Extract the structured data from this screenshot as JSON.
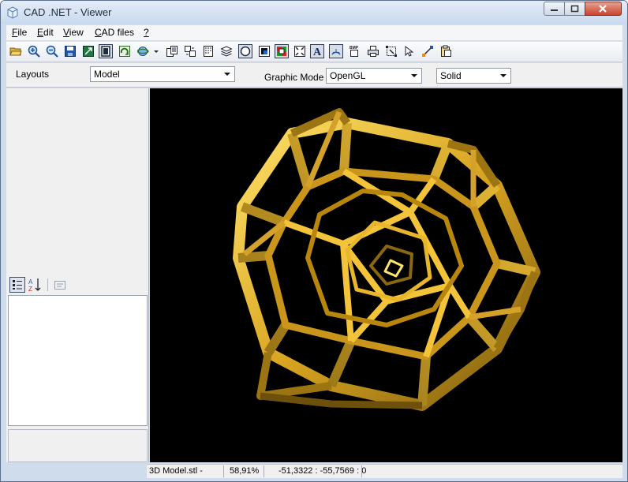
{
  "window": {
    "title": "CAD .NET - Viewer",
    "app_icon": "cube-icon"
  },
  "menu": [
    {
      "label": "File",
      "hotkey_char": "F"
    },
    {
      "label": "Edit",
      "hotkey_char": "E"
    },
    {
      "label": "View",
      "hotkey_char": "V"
    },
    {
      "label": "CAD files",
      "hotkey_char": "C"
    },
    {
      "label": "?",
      "hotkey_char": "?"
    }
  ],
  "toolbar": {
    "icons": [
      "open-folder-icon",
      "zoom-in-icon",
      "zoom-out-icon",
      "save-icon",
      "fit-to-page-icon",
      "page-view-icon",
      "rotate-icon",
      "orbit-icon",
      "dropdown-arrow-icon",
      "copy-icon",
      "copy-layout-icon",
      "sheet-icon",
      "layers-icon",
      "circle-select-icon",
      "black-background-icon",
      "color-icon",
      "fit-window-icon",
      "text-icon",
      "measure-icon",
      "export-bmp-icon",
      "print-icon",
      "select-area-icon",
      "pointer-icon",
      "snap-icon",
      "clipboard-icon"
    ],
    "bmp_label": "BMP"
  },
  "options": {
    "layouts_label": "Layouts",
    "layouts_value": "Model",
    "graphic_mode_label": "Graphic Mode",
    "graphic_mode_value": "OpenGL",
    "render_value": "Solid"
  },
  "properties": {
    "categorized_icon": "categorized-icon",
    "sort_icon": "sort-az-icon",
    "pages_icon": "property-pages-icon",
    "sort_label": "AZ"
  },
  "status": {
    "file": "3D Model.stl -",
    "zoom": "58,91%",
    "coords": "-51,3322 : -55,7569 : 0"
  },
  "colors": {
    "model_gold": "#d9a521",
    "model_highlight": "#ffe26a",
    "model_shadow": "#7a5a0c",
    "viewport_bg": "#000000",
    "accent": "#2c5fa8"
  }
}
